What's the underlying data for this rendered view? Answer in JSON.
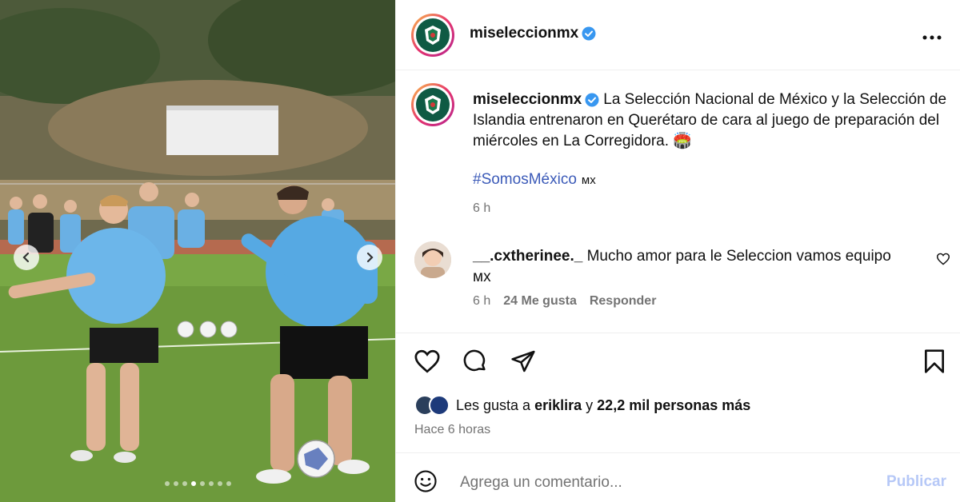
{
  "post": {
    "carousel": {
      "prev_icon": "chevron-left-icon",
      "next_icon": "chevron-right-icon",
      "slide_count": 8,
      "active_slide": 3
    },
    "header": {
      "username": "miseleccionmx",
      "more_icon": "more-horizontal-icon"
    },
    "caption": {
      "username": "miseleccionmx",
      "text": "La Selección Nacional de México y la Selección de Islandia entrenaron en Querétaro de cara al juego de preparación del miércoles en La Corregidora. 🏟️",
      "hashtag": "#SomosMéxico",
      "hashtag_suffix": "ᴍx",
      "time": "6 h"
    },
    "comment": {
      "username": "__.cxtherinee._",
      "text": "Mucho amor para le Seleccion vamos equipo ᴍx",
      "time": "6 h",
      "likes": "24 Me gusta",
      "reply": "Responder"
    },
    "likes": {
      "prefix": "Les gusta a",
      "user": "eriklira",
      "connector": "y",
      "others": "22,2 mil personas más"
    },
    "time_ago": "Hace 6 horas",
    "add_comment": {
      "placeholder": "Agrega un comentario...",
      "publish": "Publicar"
    },
    "colors": {
      "verified": "#3897f0",
      "hashtag": "#3b5ab8",
      "publish": "#b6c8f7",
      "secondary_text": "#737373"
    }
  }
}
